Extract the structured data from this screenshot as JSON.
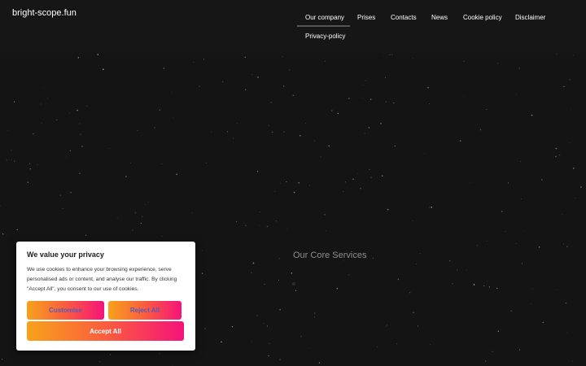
{
  "header": {
    "brand": "bright-scope.fun",
    "nav": [
      {
        "label": "Our company"
      },
      {
        "label": "Prises"
      },
      {
        "label": "Contacts"
      },
      {
        "label": "News"
      },
      {
        "label": "Cookie policy"
      },
      {
        "label": "Disclaimer"
      },
      {
        "label": "Privacy-policy"
      }
    ],
    "active_item": "Our company"
  },
  "hero": {
    "section_title": "Our Core Services"
  },
  "cookie_banner": {
    "title": "We value your privacy",
    "text": "We use cookies to enhance your browsing experience, serve personalised ads or content, and analyse our traffic. By clicking \"Accept All\", you consent to our use of cookies.",
    "buttons": {
      "customise": "Customise",
      "reject": "Reject All",
      "accept": "Accept All"
    }
  },
  "colors": {
    "background": "#141414",
    "header": "#161616",
    "button_gradient_start": "#f7a21b",
    "button_gradient_end": "#f5137a",
    "secondary_button_text": "#5b59b6"
  }
}
